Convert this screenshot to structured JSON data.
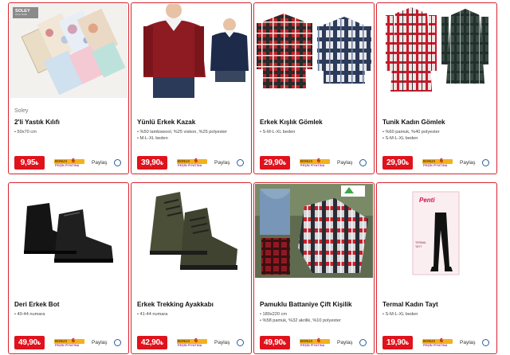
{
  "products": [
    {
      "brand": "Soley",
      "title": "2'li Yastık Kılıfı",
      "specs": [
        "• 50x70 cm"
      ],
      "price_main": "9,95",
      "price_cur": "₺",
      "taksit_label": "BONUS",
      "taksit_num": "6",
      "taksit_sub": "PEŞİN FİYATINA",
      "share": "Paylaş",
      "logo": "SOLEY",
      "logo_sub": "Home Textile"
    },
    {
      "brand": "",
      "title": "Yünlü Erkek Kazak",
      "specs": [
        "• %50 lambswool, %25 viskon, %25 polyester",
        "• M-L-XL beden"
      ],
      "price_main": "39,90",
      "price_cur": "₺",
      "taksit_label": "BONUS",
      "taksit_num": "6",
      "taksit_sub": "PEŞİN FİYATINA",
      "share": "Paylaş"
    },
    {
      "brand": "",
      "title": "Erkek Kışlık Gömlek",
      "specs": [
        "• S-M-L-XL beden"
      ],
      "price_main": "29,90",
      "price_cur": "₺",
      "taksit_label": "BONUS",
      "taksit_num": "6",
      "taksit_sub": "PEŞİN FİYATINA",
      "share": "Paylaş"
    },
    {
      "brand": "",
      "title": "Tunik Kadın Gömlek",
      "specs": [
        "• %60 pamuk, %40 polyester",
        "• S-M-L-XL beden"
      ],
      "price_main": "29,90",
      "price_cur": "₺",
      "taksit_label": "BONUS",
      "taksit_num": "6",
      "taksit_sub": "PEŞİN FİYATINA",
      "share": "Paylaş"
    },
    {
      "brand": "",
      "title": "Deri Erkek Bot",
      "specs": [
        "• 40-44 numara"
      ],
      "price_main": "49,90",
      "price_cur": "₺",
      "taksit_label": "BONUS",
      "taksit_num": "6",
      "taksit_sub": "PEŞİN FİYATINA",
      "share": "Paylaş"
    },
    {
      "brand": "",
      "title": "Erkek Trekking Ayakkabı",
      "specs": [
        "• 41-44 numara"
      ],
      "price_main": "42,90",
      "price_cur": "₺",
      "taksit_label": "BONUS",
      "taksit_num": "6",
      "taksit_sub": "PEŞİN FİYATINA",
      "share": "Paylaş"
    },
    {
      "brand": "",
      "title": "Pamuklu Battaniye Çift Kişilik",
      "specs": [
        "• 180x220 cm",
        "• %58 pamuk, %32 akrilik, %10 polyester"
      ],
      "price_main": "49,90",
      "price_cur": "₺",
      "taksit_label": "BONUS",
      "taksit_num": "6",
      "taksit_sub": "PEŞİN FİYATINA",
      "share": "Paylaş"
    },
    {
      "brand": "",
      "title": "Termal Kadın Tayt",
      "specs": [
        "• S-M-L-XL beden"
      ],
      "price_main": "19,90",
      "price_cur": "₺",
      "taksit_label": "BONUS",
      "taksit_num": "6",
      "taksit_sub": "PEŞİN FİYATINA",
      "share": "Paylaş",
      "logo": "Penti",
      "logo_sub": "TERMAL TAYT"
    }
  ],
  "colors": {
    "accent": "#e0121c",
    "border": "#d9232d",
    "taksit": "#f2b21c"
  }
}
